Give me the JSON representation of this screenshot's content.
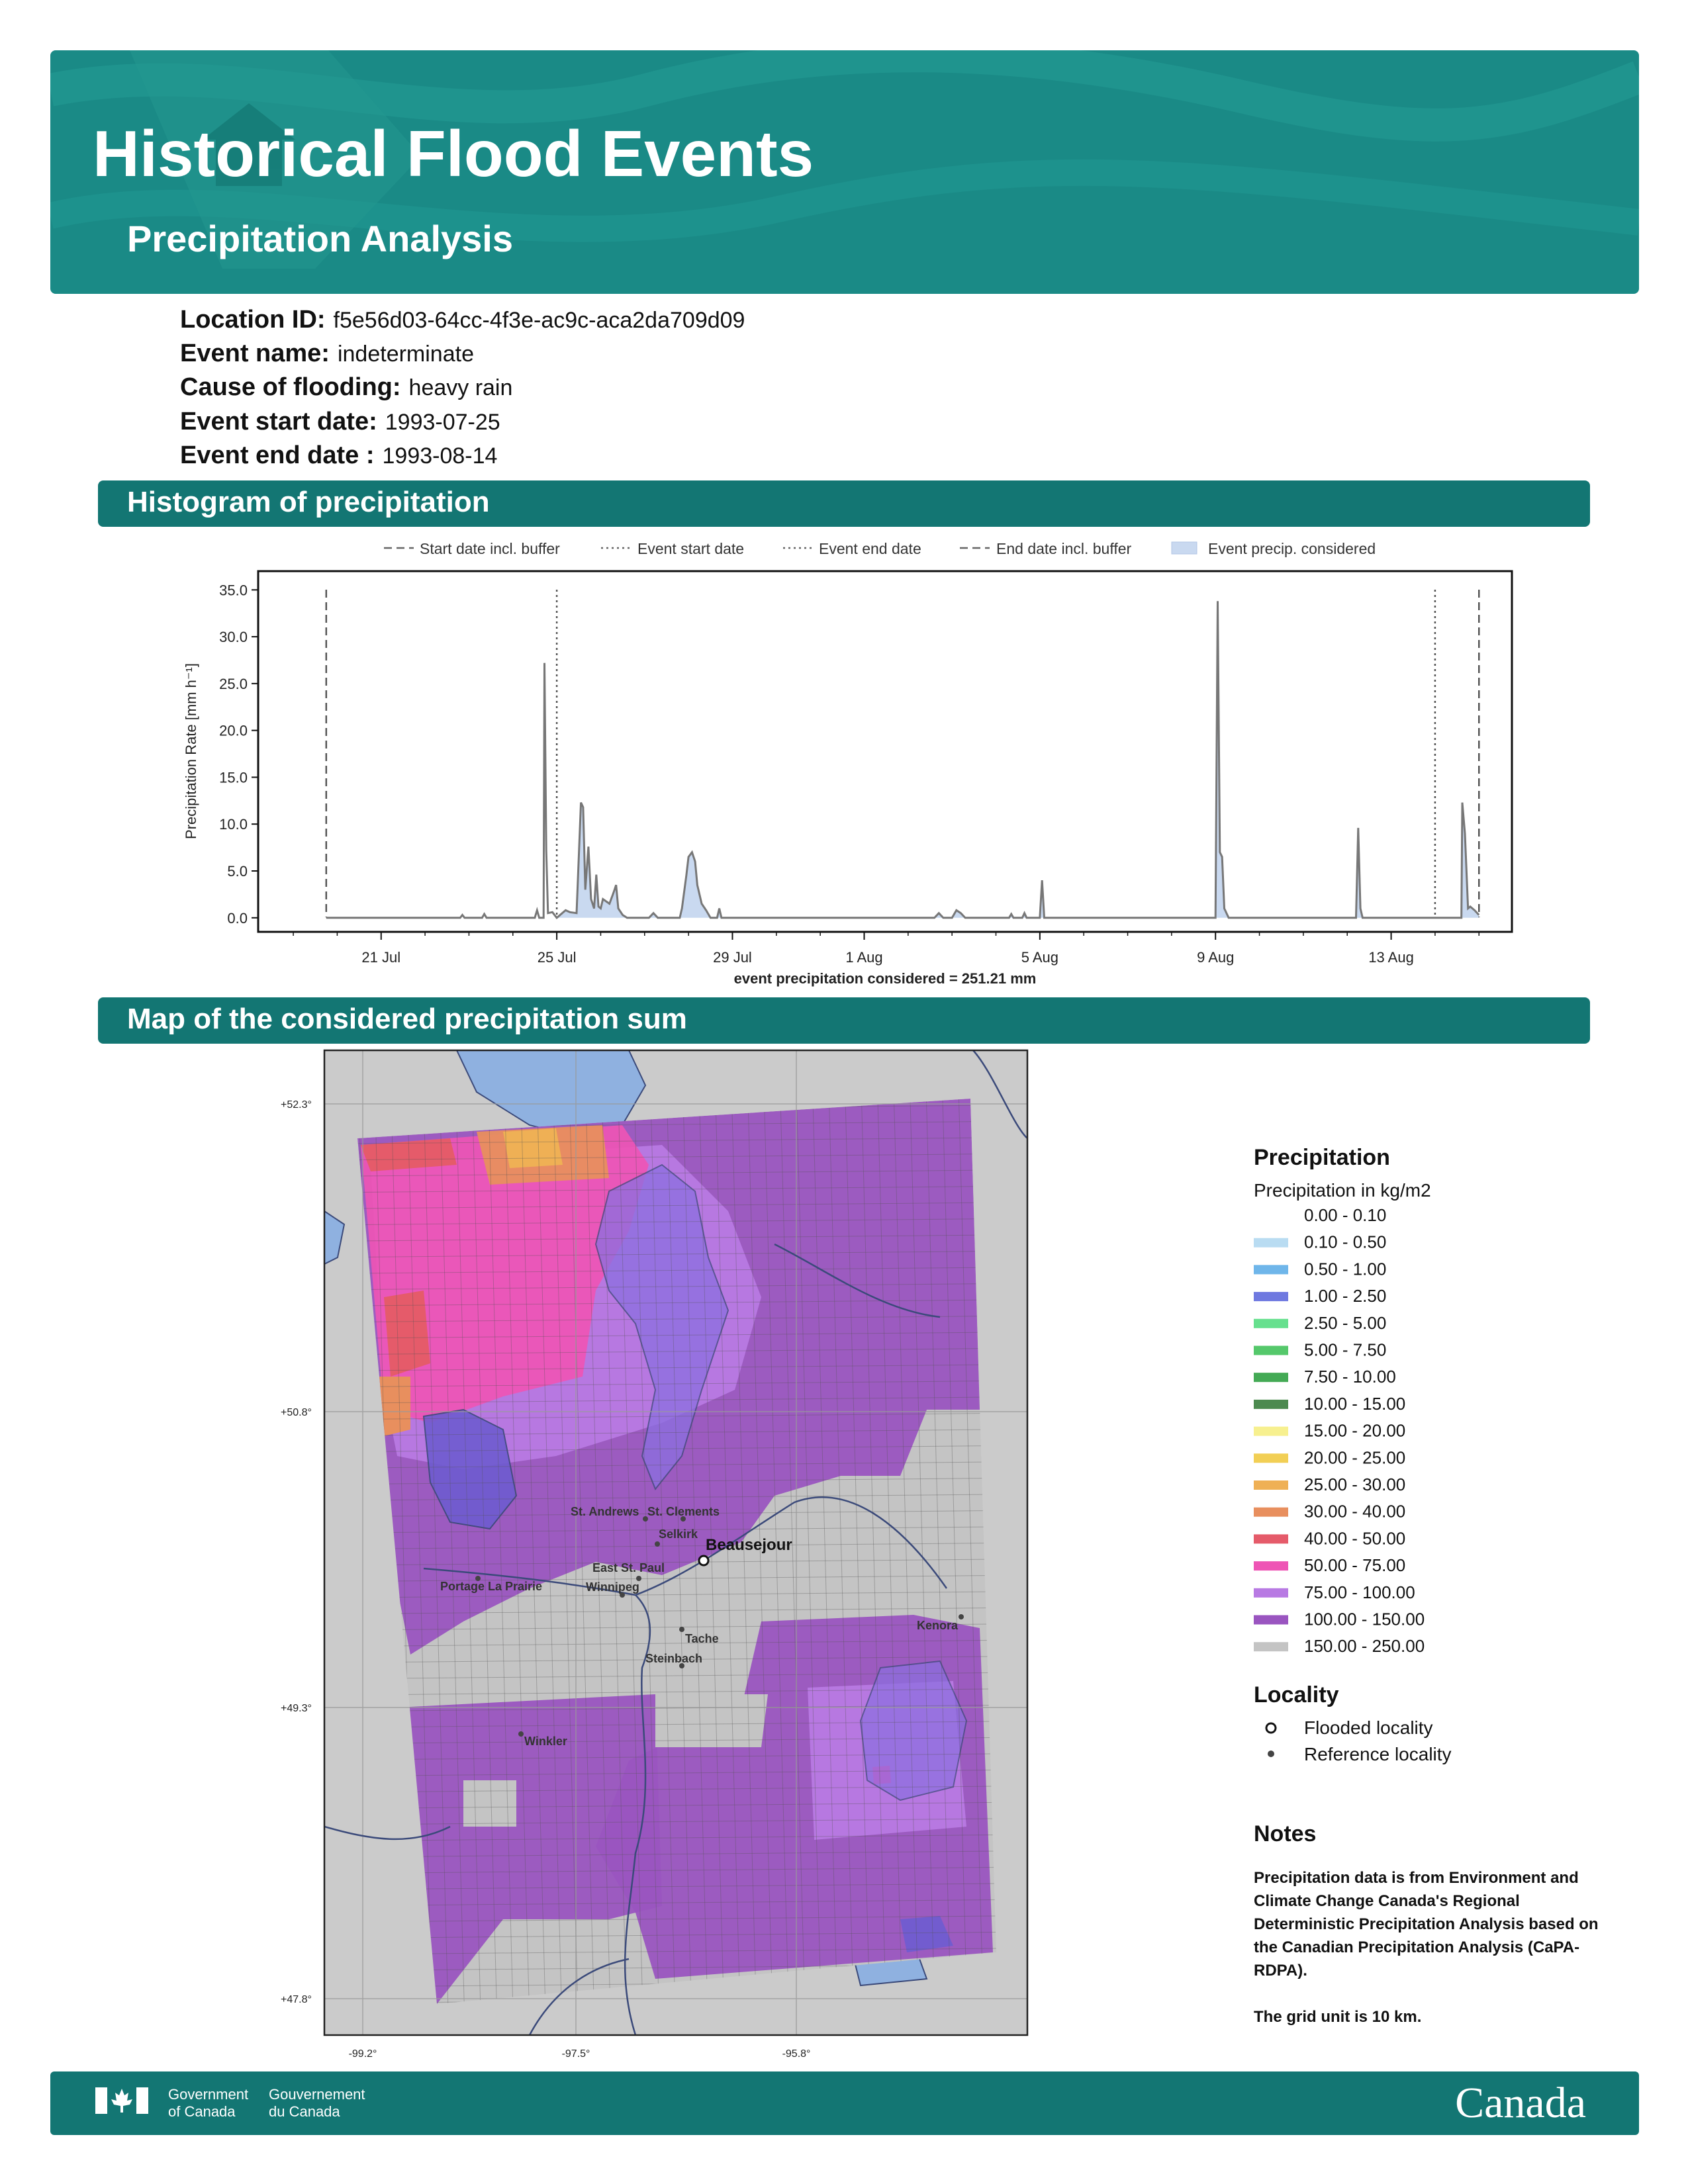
{
  "header": {
    "title": "Historical Flood Events",
    "subtitle": "Precipitation Analysis",
    "bg_color": "#1a8a86"
  },
  "info": [
    {
      "label": "Location ID:",
      "value": "f5e56d03-64cc-4f3e-ac9c-aca2da709d09"
    },
    {
      "label": "Event name:",
      "value": "indeterminate"
    },
    {
      "label": "Cause of flooding:",
      "value": "heavy rain"
    },
    {
      "label": "Event start date:",
      "value": "1993-07-25"
    },
    {
      "label": "Event end date :",
      "value": "1993-08-14"
    }
  ],
  "sections": {
    "histogram": "Histogram of precipitation",
    "map": "Map of the considered precipitation sum"
  },
  "chart_data": {
    "type": "area",
    "ylabel": "Precipitation Rate [mm h⁻¹]",
    "xlabel": "event precipitation considered = 251.21 mm",
    "ylim": [
      -1.5,
      37
    ],
    "yticks": [
      "0.0",
      "5.0",
      "10.0",
      "15.0",
      "20.0",
      "25.0",
      "30.0",
      "35.0"
    ],
    "xticks": [
      "21 Jul",
      "25 Jul",
      "29 Jul",
      "1 Aug",
      "5 Aug",
      "9 Aug",
      "13 Aug"
    ],
    "legend": [
      {
        "label": "Start date incl. buffer",
        "style": "dashed"
      },
      {
        "label": "Event start date",
        "style": "dotted"
      },
      {
        "label": "Event end date",
        "style": "dotted"
      },
      {
        "label": "End date incl. buffer",
        "style": "dashed"
      },
      {
        "label": "Event precip. considered",
        "style": "fill"
      }
    ],
    "vlines": [
      {
        "name": "Start date incl. buffer",
        "day": 19.75,
        "style": "dashed"
      },
      {
        "name": "Event start date",
        "day": 25.0,
        "style": "dotted"
      },
      {
        "name": "Event end date",
        "day": 45.0,
        "style": "dotted"
      },
      {
        "name": "End date incl. buffer",
        "day": 46.0,
        "style": "dashed"
      }
    ],
    "series": [
      {
        "values": [
          [
            19.75,
            0
          ],
          [
            22.8,
            0
          ],
          [
            22.85,
            0.3
          ],
          [
            22.9,
            0
          ],
          [
            23.3,
            0
          ],
          [
            23.35,
            0.4
          ],
          [
            23.4,
            0
          ],
          [
            24.5,
            0
          ],
          [
            24.55,
            0.8
          ],
          [
            24.6,
            0
          ],
          [
            24.7,
            0
          ],
          [
            24.72,
            27.2
          ],
          [
            24.76,
            7.2
          ],
          [
            24.8,
            0.5
          ],
          [
            24.9,
            0.6
          ],
          [
            25.0,
            0
          ],
          [
            25.2,
            0.8
          ],
          [
            25.3,
            0.6
          ],
          [
            25.45,
            0.5
          ],
          [
            25.55,
            12.3
          ],
          [
            25.6,
            11.8
          ],
          [
            25.65,
            3.0
          ],
          [
            25.72,
            7.6
          ],
          [
            25.78,
            2.0
          ],
          [
            25.85,
            1.0
          ],
          [
            25.9,
            4.6
          ],
          [
            25.95,
            1.2
          ],
          [
            26.0,
            1.0
          ],
          [
            26.05,
            2.0
          ],
          [
            26.2,
            1.5
          ],
          [
            26.3,
            2.8
          ],
          [
            26.35,
            3.5
          ],
          [
            26.4,
            1.0
          ],
          [
            26.5,
            0.3
          ],
          [
            26.6,
            0
          ],
          [
            27.1,
            0
          ],
          [
            27.2,
            0.5
          ],
          [
            27.3,
            0
          ],
          [
            27.8,
            0
          ],
          [
            27.85,
            1.0
          ],
          [
            27.95,
            4.5
          ],
          [
            28.0,
            6.5
          ],
          [
            28.08,
            7.0
          ],
          [
            28.15,
            6.0
          ],
          [
            28.2,
            3.5
          ],
          [
            28.3,
            1.5
          ],
          [
            28.4,
            0.8
          ],
          [
            28.5,
            0
          ],
          [
            28.65,
            0
          ],
          [
            28.7,
            1.0
          ],
          [
            28.75,
            0
          ],
          [
            33.6,
            0
          ],
          [
            33.7,
            0.5
          ],
          [
            33.8,
            0
          ],
          [
            34.0,
            0
          ],
          [
            34.1,
            0.8
          ],
          [
            34.2,
            0.5
          ],
          [
            34.3,
            0
          ],
          [
            35.3,
            0
          ],
          [
            35.35,
            0.4
          ],
          [
            35.4,
            0
          ],
          [
            35.6,
            0
          ],
          [
            35.65,
            0.5
          ],
          [
            35.7,
            0
          ],
          [
            36.0,
            0
          ],
          [
            36.05,
            4.0
          ],
          [
            36.1,
            0
          ],
          [
            40.0,
            0
          ],
          [
            40.05,
            33.8
          ],
          [
            40.1,
            7.0
          ],
          [
            40.15,
            6.5
          ],
          [
            40.2,
            1.0
          ],
          [
            40.3,
            0
          ],
          [
            43.2,
            0
          ],
          [
            43.25,
            9.6
          ],
          [
            43.3,
            1.0
          ],
          [
            43.35,
            0
          ],
          [
            45.6,
            0
          ],
          [
            45.62,
            12.3
          ],
          [
            45.68,
            9.0
          ],
          [
            45.75,
            1.0
          ],
          [
            45.8,
            1.2
          ],
          [
            45.9,
            0.8
          ],
          [
            46.0,
            0.3
          ]
        ]
      }
    ],
    "grid": false
  },
  "map": {
    "lat_labels": [
      "+52.3°",
      "+50.8°",
      "+49.3°",
      "+47.8°"
    ],
    "lon_labels": [
      "-99.2°",
      "-97.5°",
      "-95.8°"
    ],
    "flooded_locality": "Beausejour",
    "reference_localities": [
      "St. Andrews",
      "St. Clements",
      "Selkirk",
      "East St. Paul",
      "Winnipeg",
      "Portage La Prairie",
      "Tache",
      "Steinbach",
      "Kenora",
      "Winkler"
    ]
  },
  "legend": {
    "precip_title": "Precipitation",
    "precip_subtitle": "Precipitation in kg/m2",
    "classes": [
      {
        "label": "0.00 - 0.10",
        "color": "#ffffff"
      },
      {
        "label": "0.10 - 0.50",
        "color": "#b9dcf2"
      },
      {
        "label": "0.50 - 1.00",
        "color": "#6fb6ea"
      },
      {
        "label": "1.00 - 2.50",
        "color": "#6f79e0"
      },
      {
        "label": "2.50 - 5.00",
        "color": "#66e08e"
      },
      {
        "label": "5.00 - 7.50",
        "color": "#55c86b"
      },
      {
        "label": "7.50 - 10.00",
        "color": "#44aa55"
      },
      {
        "label": "10.00 - 15.00",
        "color": "#4c8a4f"
      },
      {
        "label": "15.00 - 20.00",
        "color": "#f7f08f"
      },
      {
        "label": "20.00 - 25.00",
        "color": "#f2cf55"
      },
      {
        "label": "25.00 - 30.00",
        "color": "#efb055"
      },
      {
        "label": "30.00 - 40.00",
        "color": "#e88f5e"
      },
      {
        "label": "40.00 - 50.00",
        "color": "#e55b6a"
      },
      {
        "label": "50.00 - 75.00",
        "color": "#ee55b5"
      },
      {
        "label": "75.00 - 100.00",
        "color": "#b87ae3"
      },
      {
        "label": "100.00 - 150.00",
        "color": "#9a55c0"
      },
      {
        "label": "150.00 - 250.00",
        "color": "#c4c4c4"
      }
    ],
    "locality_title": "Locality",
    "flooded_label": "Flooded locality",
    "reference_label": "Reference locality",
    "notes_title": "Notes",
    "notes_text1": "Precipitation data is from Environment and Climate Change Canada's Regional Deterministic Precipitation Analysis based on the Canadian Precipitation Analysis (CaPA-RDPA).",
    "notes_text2": "The grid unit is 10 km."
  },
  "footer": {
    "gov_en_1": "Government",
    "gov_en_2": "of Canada",
    "gov_fr_1": "Gouvernement",
    "gov_fr_2": "du Canada",
    "wordmark": "Canada"
  }
}
